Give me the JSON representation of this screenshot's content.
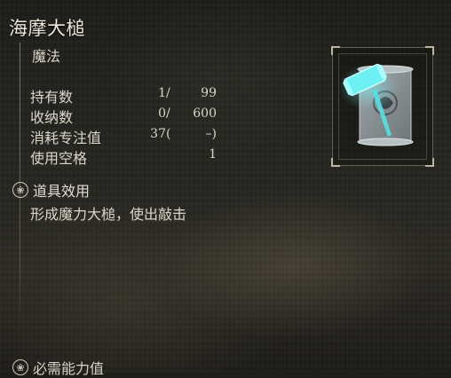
{
  "item": {
    "name": "海摩大槌",
    "category": "魔法",
    "icon": "glintstone-hammer-scroll-icon"
  },
  "stats": [
    {
      "label": "持有数",
      "a": "1",
      "sep": "/",
      "b": "99"
    },
    {
      "label": "收纳数",
      "a": "0",
      "sep": "/",
      "b": "600"
    },
    {
      "label": "消耗专注值",
      "a": "37",
      "sep": "(",
      "b": "–)"
    },
    {
      "label": "使用空格",
      "a": "",
      "sep": "",
      "b": "1"
    }
  ],
  "effect": {
    "heading": "道具效用",
    "text": "形成魔力大槌，使出敲击"
  },
  "requirements": {
    "heading": "必需能力值"
  },
  "colors": {
    "text": "#e2ddd2",
    "hammer_glow": "#5fe3e6",
    "frame": "#bfb59e"
  }
}
